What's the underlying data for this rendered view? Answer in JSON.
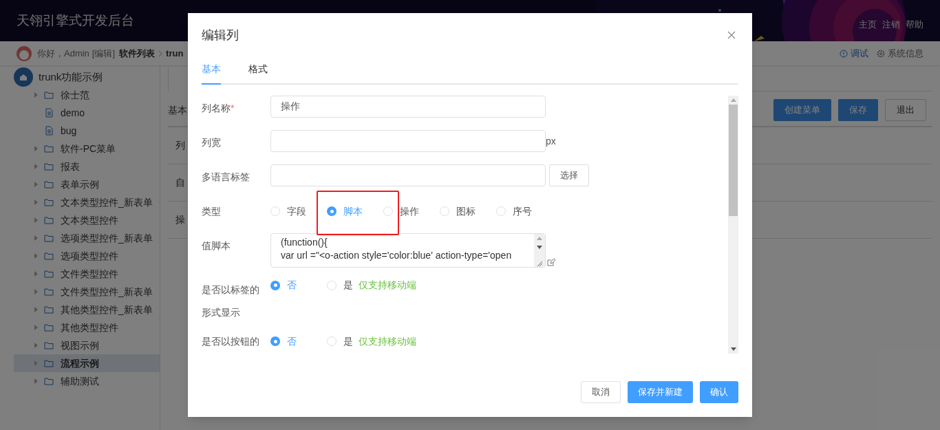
{
  "header": {
    "title": "天翎引擎式开发后台",
    "links": [
      "主页",
      "注销",
      "帮助"
    ]
  },
  "topbar": {
    "greeting": "你好，Admin",
    "edit_link": "[编辑]",
    "breadcrumb": [
      "软件列表",
      "trun"
    ],
    "debug": "调试",
    "system_info": "系统信息"
  },
  "sidebar": {
    "root": "trunk功能示例",
    "items": [
      {
        "label": "徐士范",
        "kind": "folder",
        "selected": false
      },
      {
        "label": "demo",
        "kind": "file",
        "selected": false
      },
      {
        "label": "bug",
        "kind": "file",
        "selected": false
      },
      {
        "label": "软件-PC菜单",
        "kind": "folder",
        "selected": false
      },
      {
        "label": "报表",
        "kind": "folder",
        "selected": false
      },
      {
        "label": "表单示例",
        "kind": "folder",
        "selected": false
      },
      {
        "label": "文本类型控件_新表单",
        "kind": "folder",
        "selected": false
      },
      {
        "label": "文本类型控件",
        "kind": "folder",
        "selected": false
      },
      {
        "label": "选项类型控件_新表单",
        "kind": "folder",
        "selected": false
      },
      {
        "label": "选项类型控件",
        "kind": "folder",
        "selected": false
      },
      {
        "label": "文件类型控件",
        "kind": "folder",
        "selected": false
      },
      {
        "label": "文件类型控件_新表单",
        "kind": "folder",
        "selected": false
      },
      {
        "label": "其他类型控件_新表单",
        "kind": "folder",
        "selected": false
      },
      {
        "label": "其他类型控件",
        "kind": "folder",
        "selected": false
      },
      {
        "label": "视图示例",
        "kind": "folder",
        "selected": false
      },
      {
        "label": "流程示例",
        "kind": "folder",
        "selected": true
      },
      {
        "label": "辅助测试",
        "kind": "folder",
        "selected": false
      }
    ]
  },
  "content": {
    "section": "基本",
    "rows": [
      "列",
      "自",
      "操"
    ],
    "buttons": [
      "创建菜单",
      "保存",
      "退出"
    ]
  },
  "dialog": {
    "title": "编辑列",
    "tabs": [
      {
        "label": "基本",
        "selected": true
      },
      {
        "label": "格式",
        "selected": false
      }
    ],
    "fields": [
      {
        "kind": "text",
        "label": "列名称",
        "required_mark": "*",
        "value": "操作"
      },
      {
        "kind": "text",
        "label": "列宽",
        "suffix": "px"
      },
      {
        "kind": "select",
        "label": "多语言标签",
        "button": "选择"
      },
      {
        "kind": "radio",
        "label": "类型",
        "options": [
          {
            "label": "字段",
            "selected": false
          },
          {
            "label": "脚本",
            "selected": true
          },
          {
            "label": "操作",
            "selected": false
          },
          {
            "label": "图标",
            "selected": false
          },
          {
            "label": "序号",
            "selected": false
          }
        ]
      },
      {
        "kind": "script",
        "label": "值脚本",
        "lines": [
          "(function(){",
          "var url =\"<o-action style='color:blue' action-type='open"
        ]
      },
      {
        "kind": "radio",
        "label": "是否以标签的形式显示",
        "options": [
          {
            "label": "否",
            "selected": true
          },
          {
            "label": "是",
            "selected": false
          }
        ],
        "note": "仅支持移动端"
      },
      {
        "kind": "radio",
        "label": "是否以按钮的",
        "options": [
          {
            "label": "否",
            "selected": true
          },
          {
            "label": "是",
            "selected": false
          }
        ],
        "note": "仅支持移动端"
      }
    ],
    "buttons": [
      {
        "label": "取消",
        "kind": "default"
      },
      {
        "label": "保存并新建",
        "kind": "primary"
      },
      {
        "label": "确认",
        "kind": "primary"
      }
    ]
  }
}
